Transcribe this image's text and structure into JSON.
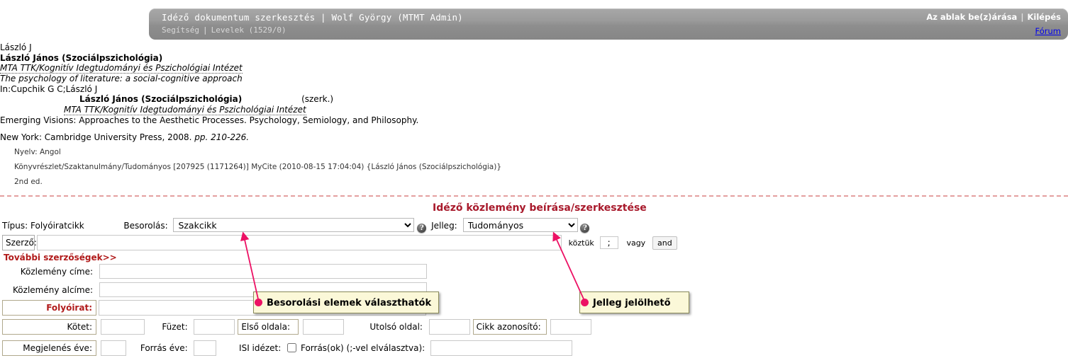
{
  "header": {
    "title": "Idéző dokumentum szerkesztés | Wolf György (MTMT Admin)",
    "help_label": "Segítség",
    "messages_label": "Levelek (1529/0)",
    "sep": "|",
    "close_window_label": "Az ablak be(z)árása",
    "logout_label": "Kilépés",
    "forum_label": "Fórum"
  },
  "citation": {
    "line1": "László J",
    "line2": "László János (Szociálpszichológia)",
    "line3": "MTA TTK/Kognitív Idegtudományi és Pszichológiai Intézet",
    "line4": "The psychology of literature: a social-cognitive approach",
    "line5": "In:Cupchik G C;László J",
    "line6_name": "László János (Szociálpszichológia)",
    "line6_role": "(szerk.)",
    "line7": "MTA TTK/Kognitív Idegtudományi és Pszichológiai Intézet",
    "line8": "Emerging Visions: Approaches to the Aesthetic Processes. Psychology, Semiology, and Philosophy.",
    "line9_pub": "New York: Cambridge University Press, 2008.",
    "line9_pages": "pp. 210-226.",
    "lang_label": "Nyelv:",
    "lang_value": "Angol",
    "meta_line": "Könyvrészlet/Szaktanulmány/Tudományos [207925 (1171264)] MyCite (2010-08-15 17:04:04) {László János (Szociálpszichológia)}",
    "edition": "2nd ed."
  },
  "form": {
    "section_title": "Idéző közlemény beírása/szerkesztése",
    "type_label": "Típus: Folyóiratcikk",
    "besorolas_label": "Besorolás:",
    "besorolas_value": "Szakcikk",
    "besorolas_options": [
      "Szakcikk"
    ],
    "jelleg_label": "Jelleg:",
    "jelleg_value": "Tudományos",
    "jelleg_options": [
      "Tudományos"
    ],
    "help_glyph": "?",
    "szerzo_label": "Szerző:",
    "szerzo_value": "",
    "koztuk_label": "köztük",
    "koztuk_value": ";",
    "vagy_label": "vagy",
    "and_label": "and",
    "tovabbi_link": "További szerzőségek>>",
    "kozlemeny_cime_label": "Közlemény címe:",
    "kozlemeny_cime_value": "",
    "kozlemeny_alcime_label": "Közlemény alcíme:",
    "kozlemeny_alcime_value": "",
    "folyoirat_label": "Folyóirat:",
    "folyoirat_value": "",
    "kotet_label": "Kötet:",
    "kotet_value": "",
    "fuzet_label": "Füzet:",
    "fuzet_value": "",
    "elso_oldala_label": "Első oldala:",
    "elso_oldala_value": "",
    "utolso_oldal_label": "Utolsó oldal:",
    "utolso_oldal_value": "",
    "cikk_azonosito_label": "Cikk azonosító:",
    "cikk_azonosito_value": "",
    "megjelenes_eve_label": "Megjelenés éve:",
    "megjelenes_eve_value": "",
    "forras_eve_label": "Forrás éve:",
    "forras_eve_value": "",
    "isi_idezet_label": "ISI idézet:",
    "isi_idezet_checked": false,
    "forrasok_label": "Forrás(ok) (;-vel elválasztva):",
    "forrasok_value": ""
  },
  "callouts": {
    "besorolas_tip": "Besorolási elemek választhatók",
    "jelleg_tip": "Jelleg jelölhető"
  },
  "colors": {
    "accent_red": "#a8192b",
    "required_red": "#b11b1b",
    "callout_bg": "#fbf8d8",
    "arrow_pink": "#ec1164",
    "header_gray": "#9a9a9a"
  }
}
